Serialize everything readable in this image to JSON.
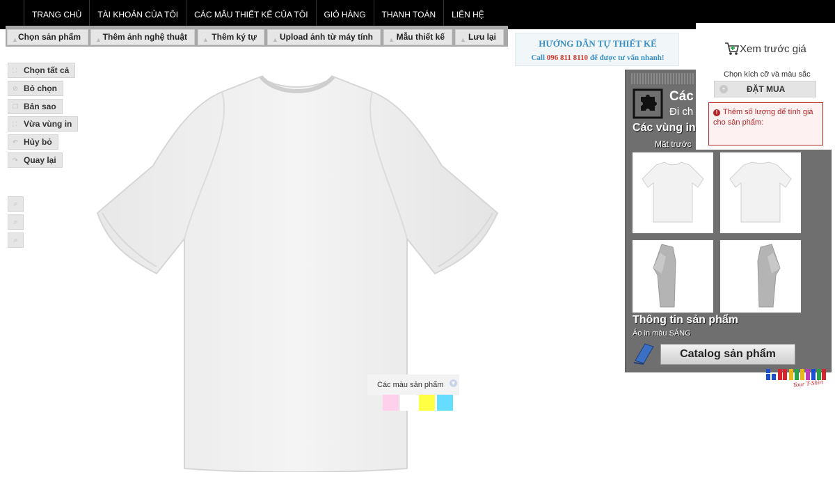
{
  "nav": {
    "items": [
      "TRANG CHỦ",
      "TÀI KHOẢN CỦA TÔI",
      "CÁC MẪU THIẾT KẾ CỦA TÔI",
      "GIỎ HÀNG",
      "THANH TOÁN",
      "LIÊN HỆ"
    ]
  },
  "toolbar": {
    "choose_product": "Chọn sản phẩm",
    "add_art": "Thêm ảnh nghệ thuật",
    "add_text": "Thêm ký tự",
    "upload": "Upload ảnh từ máy tính",
    "design_templates": "Mẫu thiết kế",
    "save": "Lưu lại"
  },
  "guide": {
    "title": "HƯỚNG DẪN TỰ THIẾT KẾ",
    "call_prefix": "Call",
    "phone": "096 811 8110",
    "call_suffix": "để được tư vấn nhanh!"
  },
  "left_tools": {
    "select_all": "Chọn tất cả",
    "deselect": "Bỏ chọn",
    "copy": "Bản sao",
    "fit_print": "Vừa vùng in",
    "cancel": "Hủy bỏ",
    "back": "Quay lại"
  },
  "colors": {
    "label": "Các màu sản phẩm",
    "swatches": [
      "#ffd0ec",
      "#ffffff",
      "#ffff44",
      "#66ddff"
    ]
  },
  "panel": {
    "header_big": "Các",
    "header_sub": "Đi ch",
    "print_areas": "Các vùng in",
    "front": "Mặt trước",
    "product_info": "Thông tin sản phẩm",
    "product_type": "Áo in màu SÁNG",
    "catalog_button": "Catalog sản phẩm"
  },
  "price": {
    "title": "Xem trước giá",
    "choose": "Chọn kích cỡ và màu sắc",
    "order_button": "ĐẶT MUA",
    "alert": "Thêm số lượng để tính giá cho sản phẩm:"
  },
  "brand": {
    "logo_text": "Your T-Shirt"
  }
}
